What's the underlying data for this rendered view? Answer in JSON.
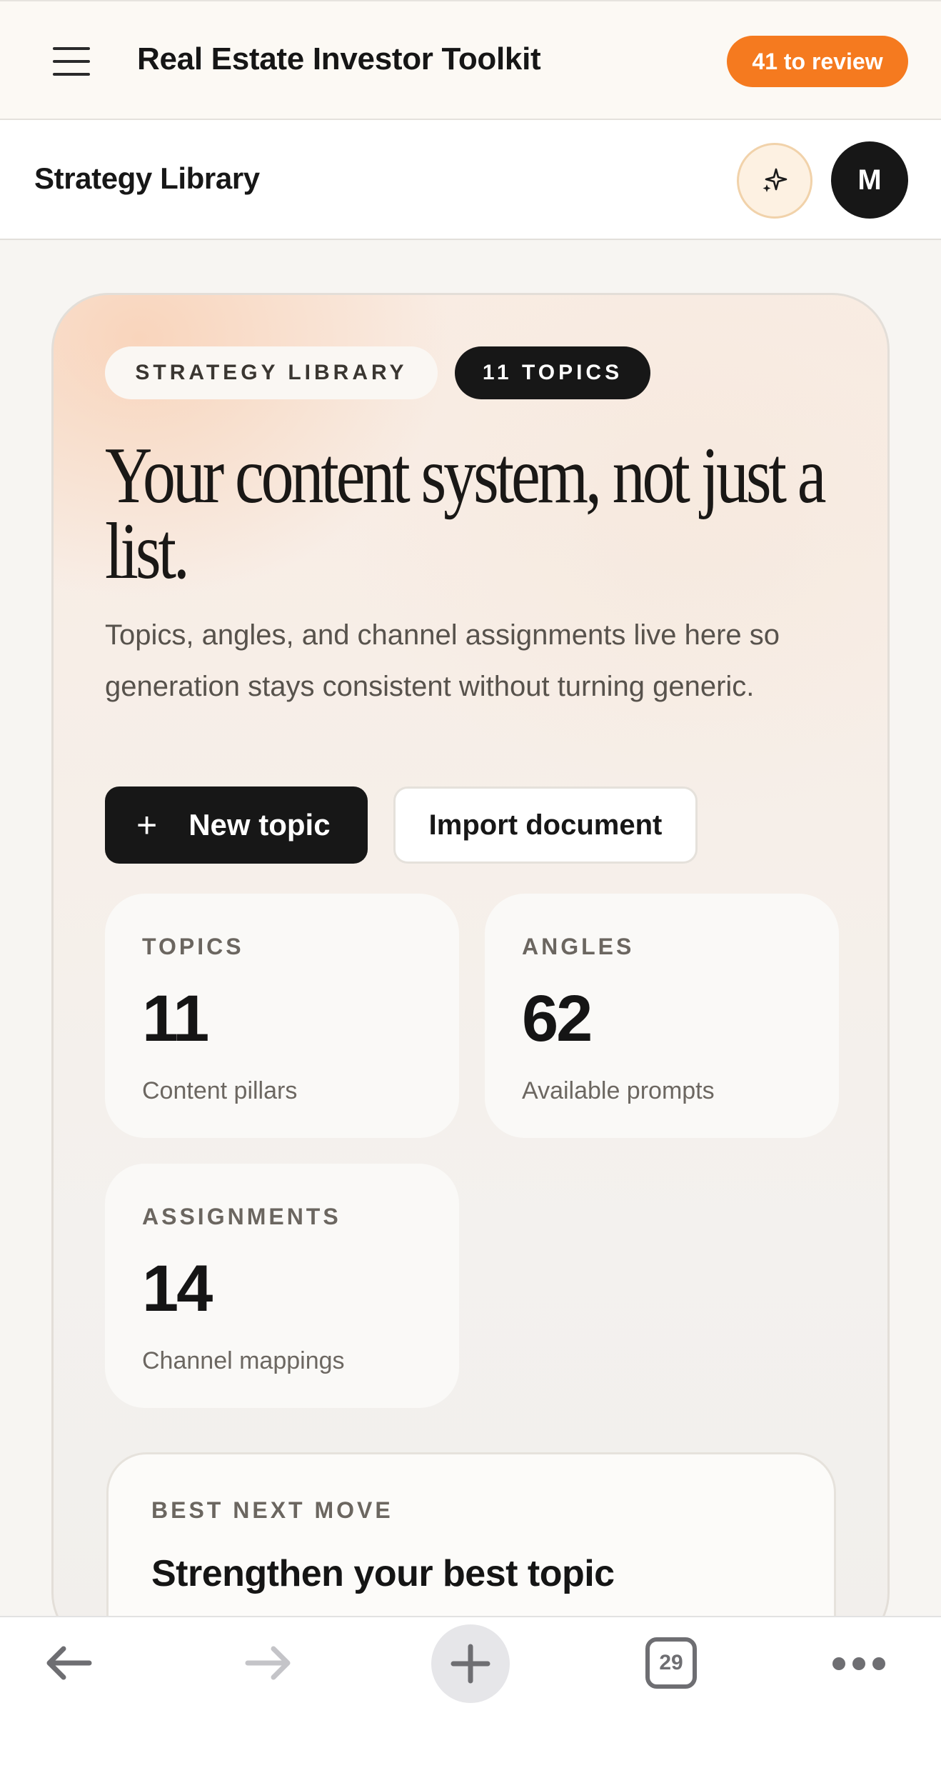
{
  "topbar": {
    "menu_icon": "hamburger-menu-icon",
    "app_title": "Real Estate Investor Toolkit",
    "review_badge": "41 to review",
    "accent_color": "#f57a1f"
  },
  "subbar": {
    "page_title": "Strategy Library",
    "sparkle_icon": "sparkle-icon",
    "avatar_initial": "M"
  },
  "hero": {
    "chips": [
      "STRATEGY LIBRARY",
      "11 TOPICS"
    ],
    "headline": "Your content system, not just a list.",
    "description": "Topics, angles, and channel assignments live here so generation stays consistent without turning generic.",
    "primary_button": "New topic",
    "primary_button_icon": "plus-icon",
    "secondary_button": "Import document"
  },
  "stats": [
    {
      "label": "TOPICS",
      "value": "11",
      "sub": "Content pillars"
    },
    {
      "label": "ANGLES",
      "value": "62",
      "sub": "Available prompts"
    },
    {
      "label": "ASSIGNMENTS",
      "value": "14",
      "sub": "Channel mappings"
    }
  ],
  "next_move": {
    "label": "BEST NEXT MOVE",
    "title": "Strengthen your best topic"
  },
  "browser_bar": {
    "back_icon": "back-arrow-icon",
    "forward_icon": "forward-arrow-icon",
    "new_tab_icon": "plus-icon",
    "tab_count": "29",
    "more_icon": "more-dots-icon"
  }
}
